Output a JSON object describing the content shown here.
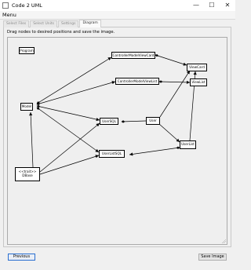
{
  "window": {
    "title": "Code 2 UML",
    "minimize_glyph": "—",
    "maximize_glyph": "☐",
    "close_glyph": "✕"
  },
  "menu": {
    "label": "Menu"
  },
  "tabs": [
    {
      "label": "Select Files",
      "active": false
    },
    {
      "label": "Select Units",
      "active": false
    },
    {
      "label": "Settings",
      "active": false
    },
    {
      "label": "Diagram",
      "active": true
    }
  ],
  "instruction": "Drag nodes to desired positions and save the image.",
  "diagram": {
    "nodes": {
      "program": {
        "label": "Program"
      },
      "cmvc": {
        "label": "ControllerModelViewCard"
      },
      "viewcard": {
        "label": "ViewCard"
      },
      "cmvl": {
        "label": "ControllerModelViewList"
      },
      "viewlist": {
        "label": "ViewList"
      },
      "model": {
        "label": "Model"
      },
      "usersql": {
        "label": "UserSQL"
      },
      "user": {
        "label": "User"
      },
      "userlist": {
        "label": "UserList"
      },
      "userlistsql": {
        "label": "UserListSQL"
      },
      "dbase_stereotype": {
        "label": "<<trait>>"
      },
      "dbase": {
        "label": "DBase"
      }
    }
  },
  "buttons": {
    "previous": "Previous",
    "save_image": "Save Image"
  },
  "colors": {
    "focus_border": "#2a6fd0",
    "window_bg": "#f0f0f0"
  }
}
